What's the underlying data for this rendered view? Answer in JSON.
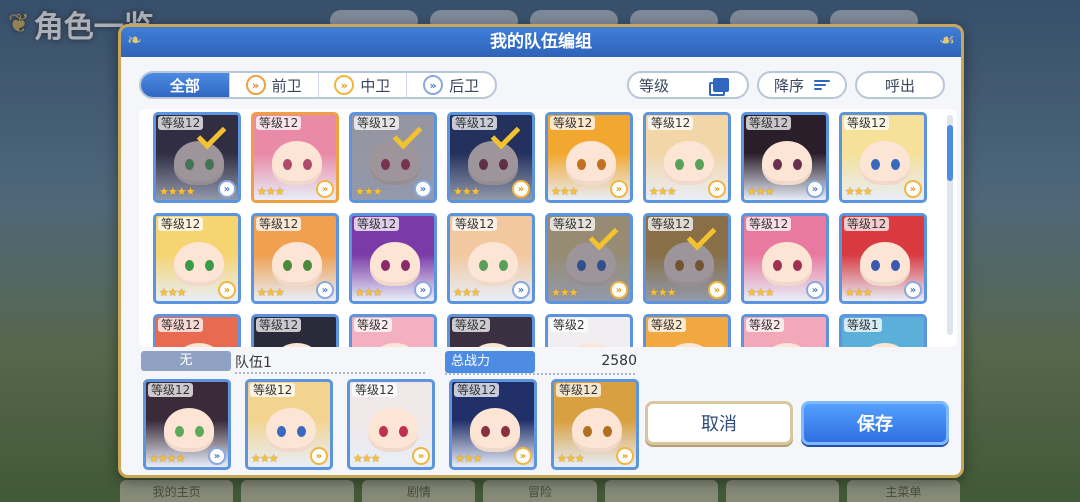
{
  "background": {
    "title": "角色一览",
    "bottom_nav": [
      "我的主页",
      "",
      "剧情",
      "冒险",
      "",
      "",
      "主菜单"
    ]
  },
  "dialog": {
    "title": "我的队伍编组"
  },
  "filters": {
    "tabs": [
      {
        "label": "全部",
        "active": true
      },
      {
        "label": "前卫",
        "active": false,
        "icon": "frontline-icon"
      },
      {
        "label": "中卫",
        "active": false,
        "icon": "midline-icon"
      },
      {
        "label": "后卫",
        "active": false,
        "icon": "backline-icon"
      }
    ],
    "level_label": "等级",
    "sort_label": "降序",
    "call_label": "呼出"
  },
  "roster": {
    "cards": [
      {
        "level": "等级12",
        "stars": "★★★★",
        "selected": true,
        "border": "blue",
        "hair": "#3a2a3a",
        "eyes": "#5aaa5a",
        "role": "blue"
      },
      {
        "level": "等级12",
        "stars": "★★★",
        "selected": false,
        "border": "orange",
        "hair": "#e88aa8",
        "eyes": "#b04a6a",
        "role": "orange"
      },
      {
        "level": "等级12",
        "stars": "★★★",
        "selected": true,
        "border": "blue",
        "hair": "#f0e8e8",
        "eyes": "#c03050",
        "role": "blue"
      },
      {
        "level": "等级12",
        "stars": "★★★",
        "selected": true,
        "border": "blue",
        "hair": "#22306a",
        "eyes": "#8a3040",
        "role": "orange"
      },
      {
        "level": "等级12",
        "stars": "★★★",
        "selected": false,
        "border": "blue",
        "hair": "#f2a830",
        "eyes": "#c07020",
        "role": "orange"
      },
      {
        "level": "等级12",
        "stars": "★★★",
        "selected": false,
        "border": "blue",
        "hair": "#f2d6a8",
        "eyes": "#5aa05a",
        "role": "orange"
      },
      {
        "level": "等级12",
        "stars": "★★★",
        "selected": false,
        "border": "blue",
        "hair": "#2a1e2a",
        "eyes": "#6a3050",
        "role": "blue"
      },
      {
        "level": "等级12",
        "stars": "★★★",
        "selected": false,
        "border": "blue",
        "hair": "#f6e09a",
        "eyes": "#3a6ac0",
        "role": "orange"
      },
      {
        "level": "等级12",
        "stars": "★★★",
        "selected": false,
        "border": "blue",
        "hair": "#f6d470",
        "eyes": "#3a9a4a",
        "role": "orange"
      },
      {
        "level": "等级12",
        "stars": "★★★",
        "selected": false,
        "border": "blue",
        "hair": "#f0a050",
        "eyes": "#4a8a3a",
        "role": "blue"
      },
      {
        "level": "等级12",
        "stars": "★★★",
        "selected": false,
        "border": "blue",
        "hair": "#7a3aa8",
        "eyes": "#8a2a6a",
        "role": "blue"
      },
      {
        "level": "等级12",
        "stars": "★★★",
        "selected": false,
        "border": "blue",
        "hair": "#f2c8a0",
        "eyes": "#5aa05a",
        "role": "blue"
      },
      {
        "level": "等级12",
        "stars": "★★★",
        "selected": true,
        "border": "blue",
        "hair": "#f2d490",
        "eyes": "#3a6ac0",
        "role": "orange"
      },
      {
        "level": "等级12",
        "stars": "★★★",
        "selected": true,
        "border": "blue",
        "hair": "#d8a040",
        "eyes": "#b07020",
        "role": "orange"
      },
      {
        "level": "等级12",
        "stars": "★★★",
        "selected": false,
        "border": "blue",
        "hair": "#e87aa0",
        "eyes": "#a03050",
        "role": "blue"
      },
      {
        "level": "等级12",
        "stars": "★★★",
        "selected": false,
        "border": "blue",
        "hair": "#d83a40",
        "eyes": "#3a5ab0",
        "role": "blue"
      },
      {
        "level": "等级12",
        "stars": "",
        "selected": false,
        "border": "blue",
        "hair": "#e86a50",
        "eyes": "#a04030",
        "role": ""
      },
      {
        "level": "等级12",
        "stars": "",
        "selected": false,
        "border": "blue",
        "hair": "#2a2a3a",
        "eyes": "#4a4a6a",
        "role": ""
      },
      {
        "level": "等级2",
        "stars": "",
        "selected": false,
        "border": "blue",
        "hair": "#f2b0c0",
        "eyes": "#a05070",
        "role": ""
      },
      {
        "level": "等级2",
        "stars": "",
        "selected": false,
        "border": "blue",
        "hair": "#3a3040",
        "eyes": "#6a4050",
        "role": ""
      },
      {
        "level": "等级2",
        "stars": "",
        "selected": false,
        "border": "blue",
        "hair": "#f0eef0",
        "eyes": "#a06070",
        "role": ""
      },
      {
        "level": "等级2",
        "stars": "",
        "selected": false,
        "border": "blue",
        "hair": "#f2a840",
        "eyes": "#b07020",
        "role": ""
      },
      {
        "level": "等级2",
        "stars": "",
        "selected": false,
        "border": "blue",
        "hair": "#f2a8b8",
        "eyes": "#a05070",
        "role": ""
      },
      {
        "level": "等级1",
        "stars": "",
        "selected": false,
        "border": "blue",
        "hair": "#5ab0d8",
        "eyes": "#3a7aa0",
        "role": ""
      }
    ]
  },
  "team": {
    "tag": "无",
    "name": "队伍1",
    "power_label": "总战力",
    "power_value": "2580",
    "members": [
      {
        "level": "等级12",
        "stars": "★★★★",
        "border": "blue",
        "hair": "#3a2a3a",
        "eyes": "#5aaa5a",
        "role": "blue"
      },
      {
        "level": "等级12",
        "stars": "★★★",
        "border": "blue",
        "hair": "#f2d490",
        "eyes": "#3a6ac0",
        "role": "orange"
      },
      {
        "level": "等级12",
        "stars": "★★★",
        "border": "blue",
        "hair": "#f0e8e8",
        "eyes": "#c03050",
        "role": "orange"
      },
      {
        "level": "等级12",
        "stars": "★★★",
        "border": "blue",
        "hair": "#22306a",
        "eyes": "#8a3040",
        "role": "orange"
      },
      {
        "level": "等级12",
        "stars": "★★★",
        "border": "blue",
        "hair": "#d8a040",
        "eyes": "#b07020",
        "role": "orange"
      }
    ]
  },
  "actions": {
    "cancel_label": "取消",
    "save_label": "保存"
  }
}
